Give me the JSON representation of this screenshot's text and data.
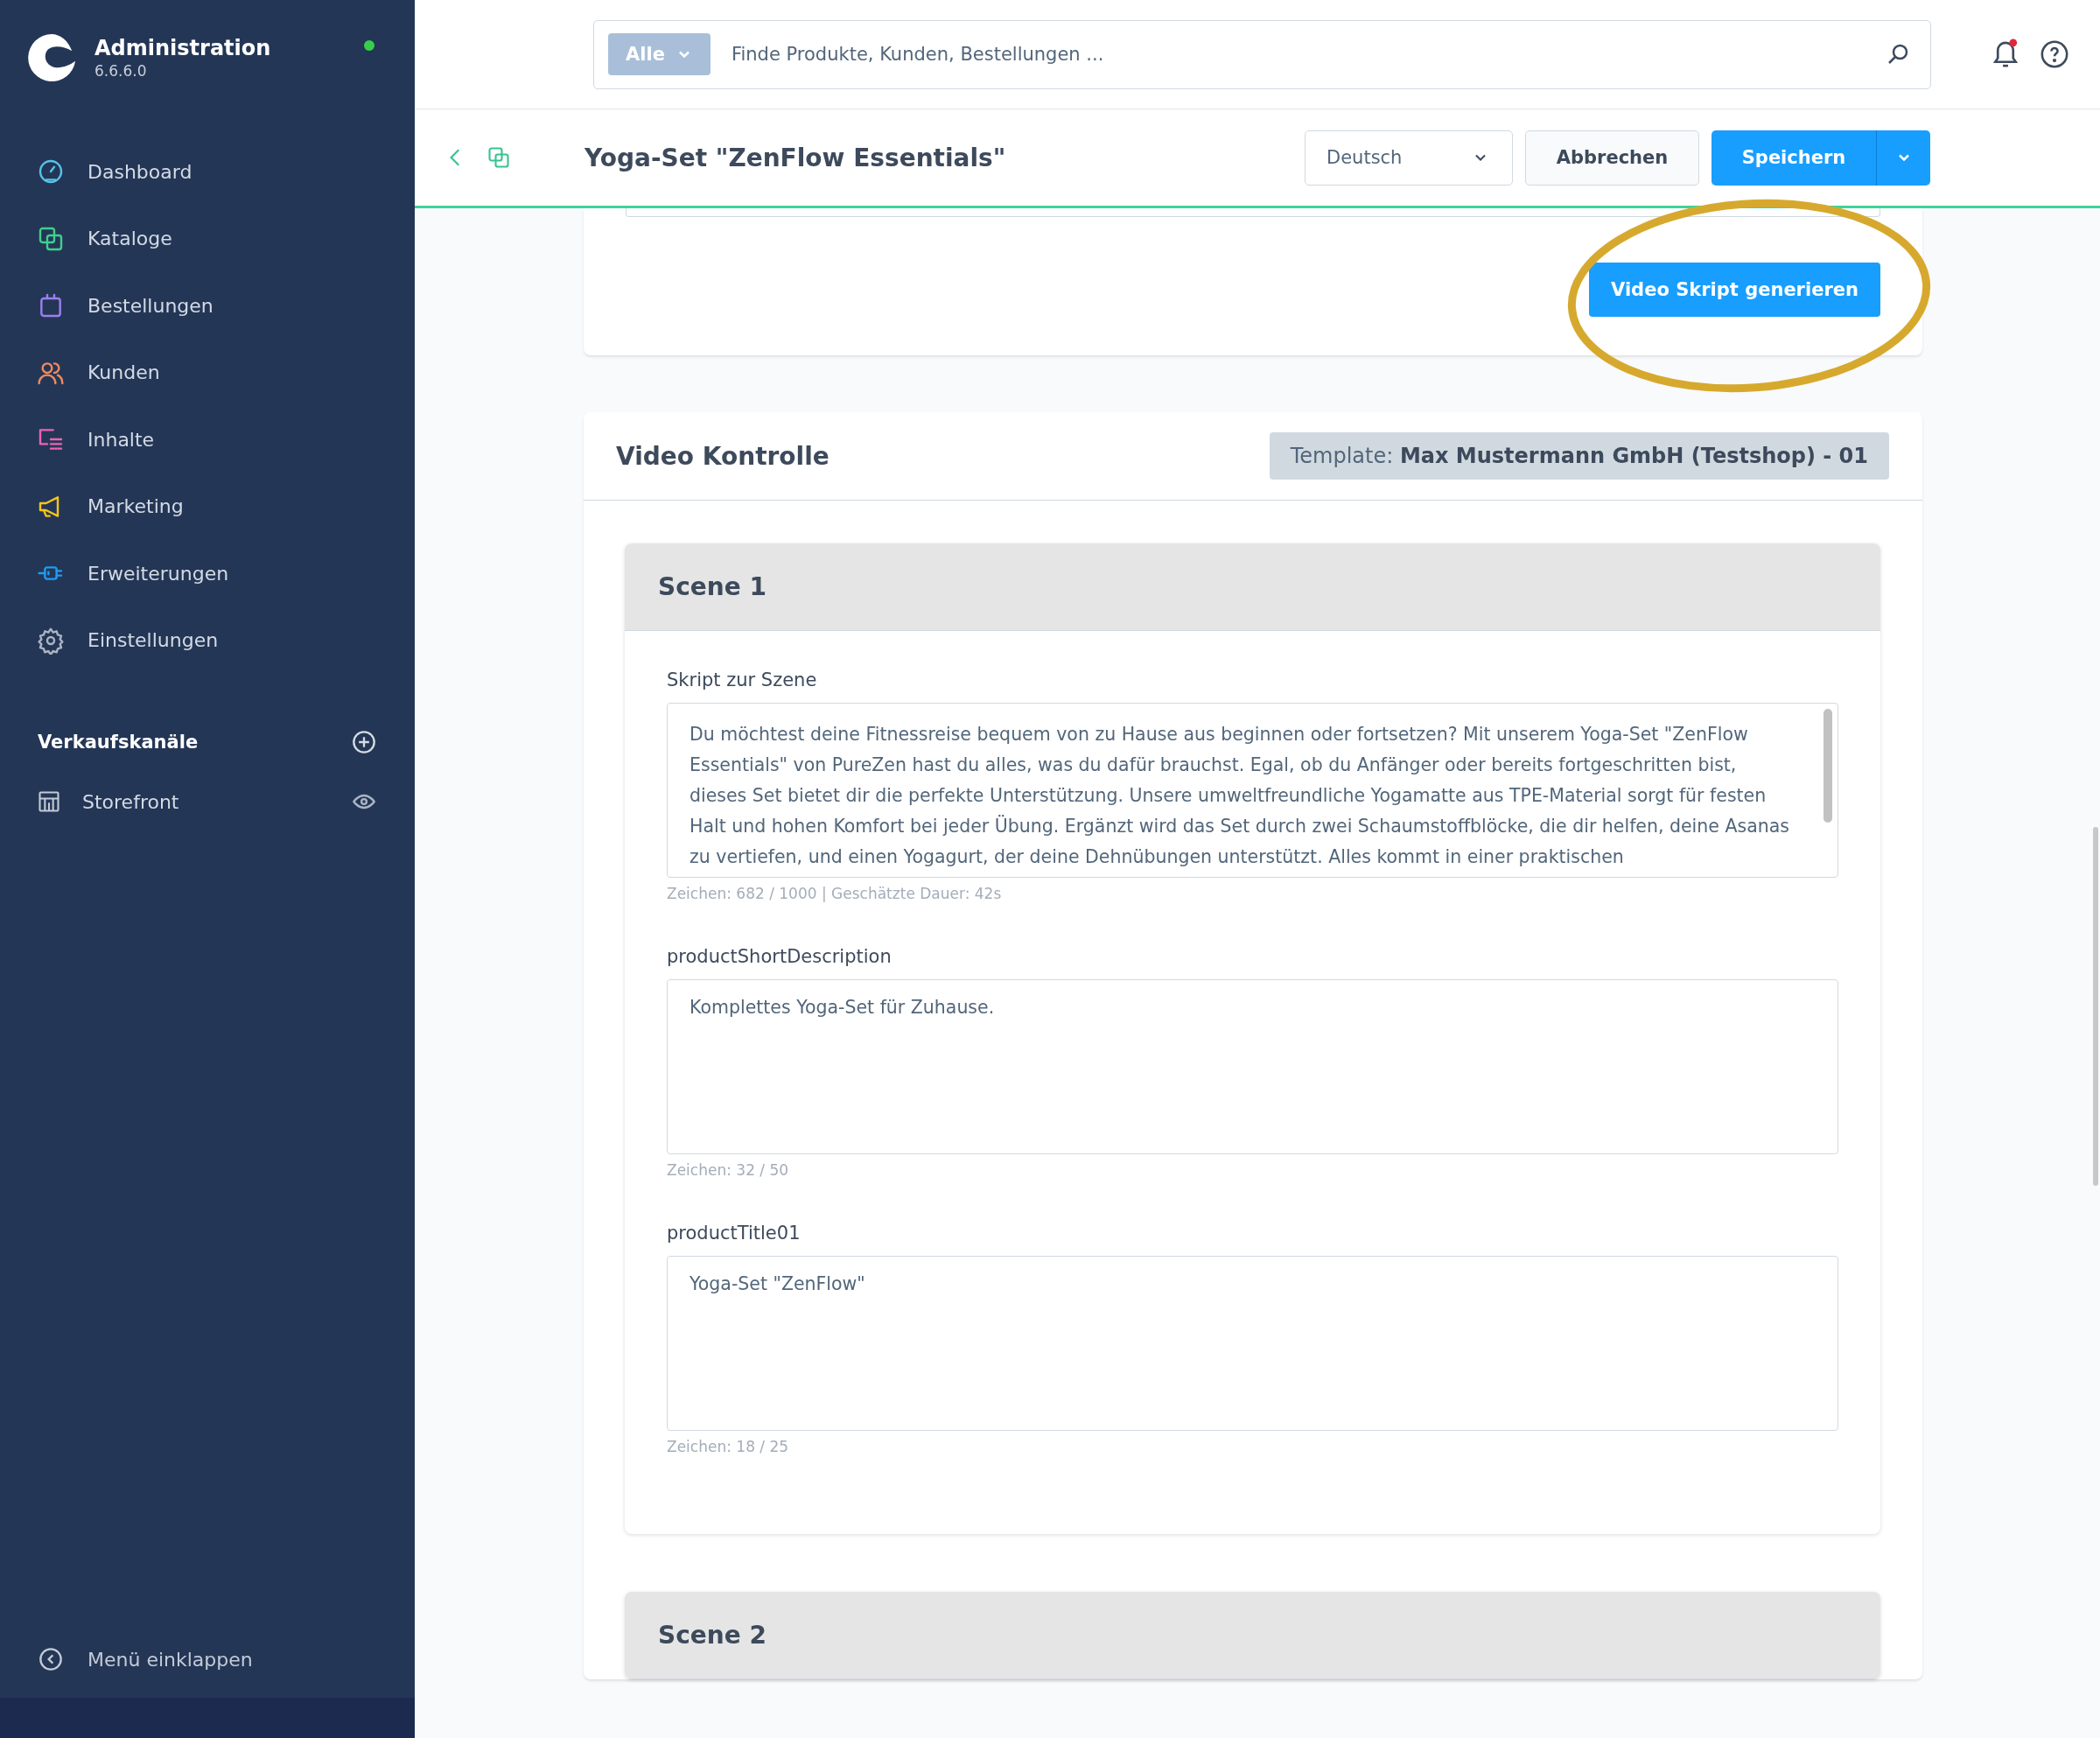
{
  "app": {
    "title": "Administration",
    "version": "6.6.6.0"
  },
  "nav": [
    {
      "label": "Dashboard",
      "color": "#57c3e8"
    },
    {
      "label": "Kataloge",
      "color": "#3fcf8e"
    },
    {
      "label": "Bestellungen",
      "color": "#9b7ff0"
    },
    {
      "label": "Kunden",
      "color": "#f08a5d"
    },
    {
      "label": "Inhalte",
      "color": "#f062b0"
    },
    {
      "label": "Marketing",
      "color": "#f5c518"
    },
    {
      "label": "Erweiterungen",
      "color": "#1f9cf0"
    },
    {
      "label": "Einstellungen",
      "color": "#aab4c3"
    }
  ],
  "sales_channels": {
    "title": "Verkaufskanäle",
    "items": [
      {
        "label": "Storefront"
      }
    ]
  },
  "collapse_label": "Menü einklappen",
  "search": {
    "filter": "Alle",
    "placeholder": "Finde Produkte, Kunden, Bestellungen ..."
  },
  "page": {
    "title": "Yoga-Set \"ZenFlow Essentials\"",
    "language": "Deutsch",
    "cancel": "Abbrechen",
    "save": "Speichern"
  },
  "generate_button": "Video Skript generieren",
  "video_control": {
    "title": "Video Kontrolle",
    "template": "Template: **Max Mustermann GmbH (Testshop) - 01**"
  },
  "scenes": [
    {
      "title": "Scene 1",
      "fields": [
        {
          "label": "Skript zur Szene",
          "value": "Du möchtest deine Fitnessreise bequem von zu Hause aus beginnen oder fortsetzen? Mit unserem Yoga-Set \"ZenFlow Essentials\" von PureZen hast du alles, was du dafür brauchst. Egal, ob du Anfänger oder bereits fortgeschritten bist, dieses Set bietet dir die perfekte Unterstützung. Unsere umweltfreundliche Yogamatte aus TPE-Material sorgt für festen Halt und hohen Komfort bei jeder Übung. Ergänzt wird das Set durch zwei Schaumstoffblöcke, die dir helfen, deine Asanas zu vertiefen, und einen Yogagurt, der deine Dehnübungen unterstützt. Alles kommt in einer praktischen",
          "counter": "Zeichen: 682 / 1000 | Geschätzte Dauer: 42s",
          "scrollbar": true
        },
        {
          "label": "productShortDescription",
          "value": "Komplettes Yoga-Set für Zuhause.",
          "counter": "Zeichen: 32 / 50",
          "scrollbar": false
        },
        {
          "label": "productTitle01",
          "value": "Yoga-Set \"ZenFlow\"",
          "counter": "Zeichen: 18 / 25",
          "scrollbar": false
        }
      ]
    },
    {
      "title": "Scene 2"
    }
  ]
}
